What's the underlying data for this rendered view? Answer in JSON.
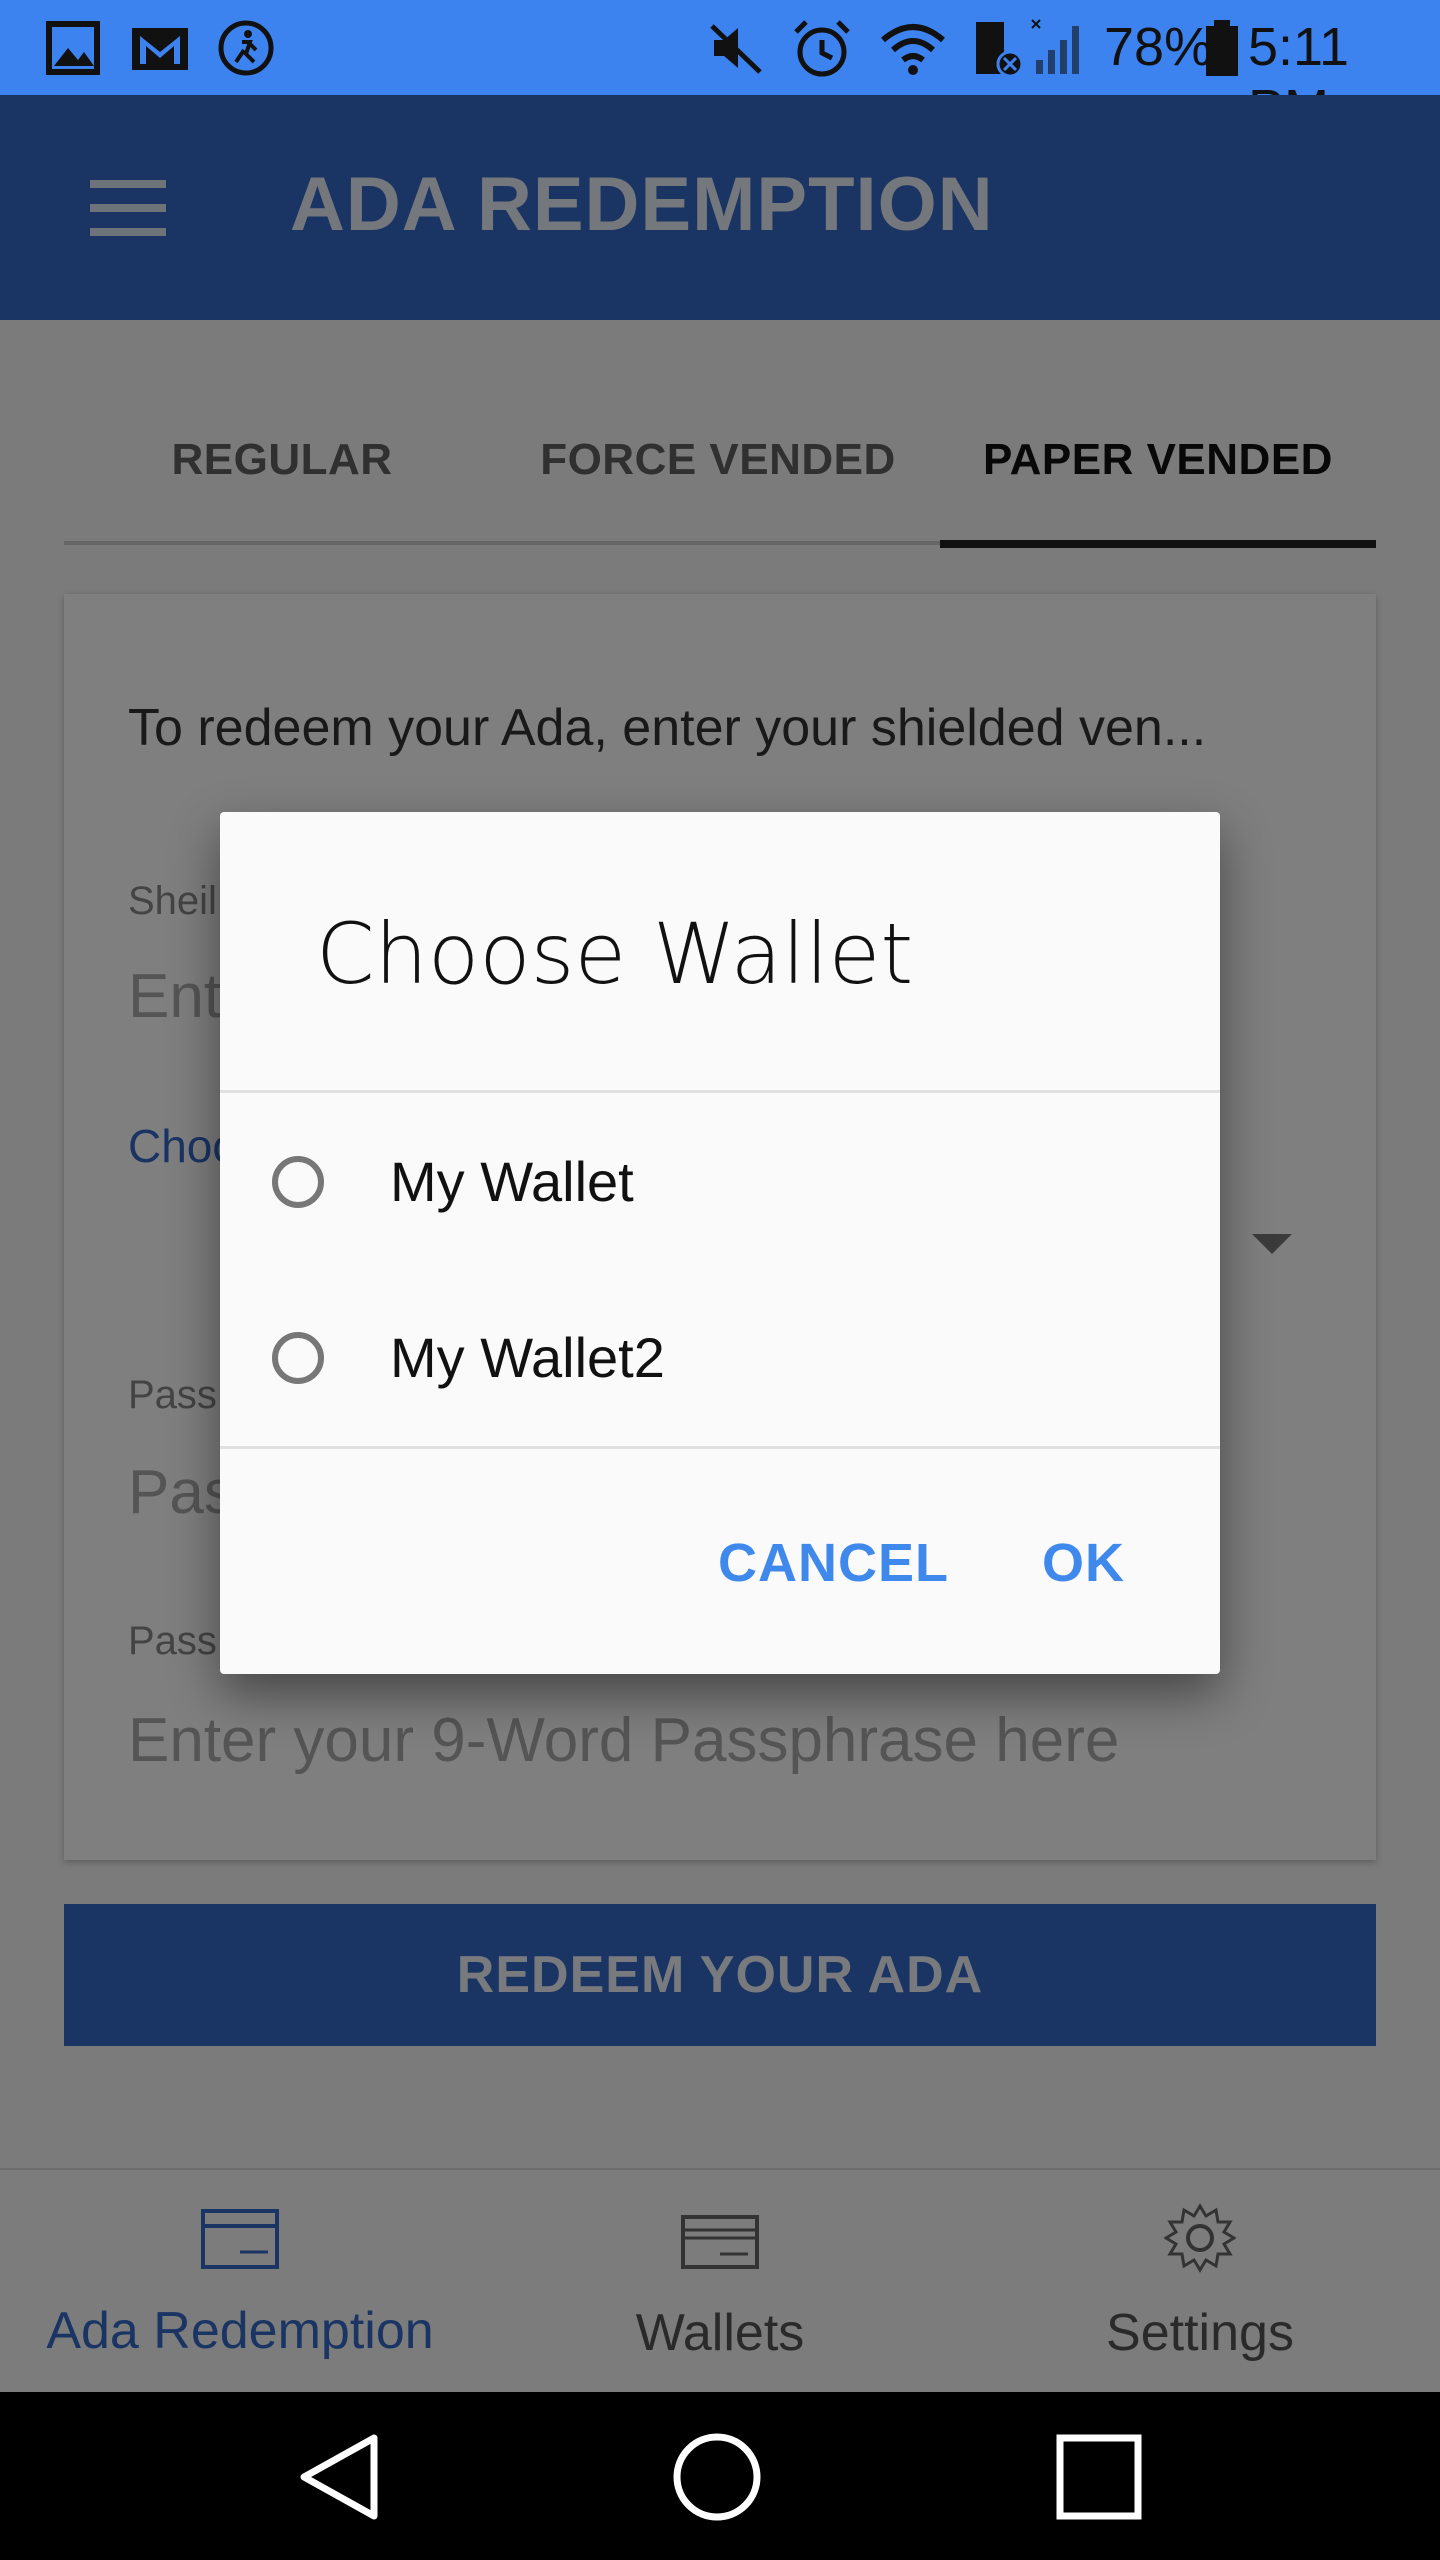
{
  "status_bar": {
    "battery": "78%",
    "time": "5:11 PM"
  },
  "app_bar": {
    "title": "ADA REDEMPTION"
  },
  "tabs": [
    {
      "label": "REGULAR",
      "active": false
    },
    {
      "label": "FORCE VENDED",
      "active": false
    },
    {
      "label": "PAPER VENDED",
      "active": true
    }
  ],
  "card": {
    "instructions": "To redeem your Ada, enter your shielded ven...",
    "shielded_label": "Sheil",
    "shielded_placeholder": "Ent",
    "choose_wallet_label": "Choo",
    "passphrase_label_partial": "Pass",
    "passphrase_placeholder_partial": "Pas",
    "passphrase9_label": "Pass",
    "passphrase9_placeholder": "Enter your 9-Word Passphrase here"
  },
  "redeem_button": "REDEEM YOUR ADA",
  "bottom_nav": [
    {
      "label": "Ada Redemption",
      "icon": "card-icon",
      "active": true
    },
    {
      "label": "Wallets",
      "icon": "wallet-icon",
      "active": false
    },
    {
      "label": "Settings",
      "icon": "gear-icon",
      "active": false
    }
  ],
  "dialog": {
    "title": "Choose Wallet",
    "options": [
      {
        "label": "My Wallet",
        "selected": false
      },
      {
        "label": "My Wallet2",
        "selected": false
      }
    ],
    "cancel_label": "CANCEL",
    "ok_label": "OK"
  },
  "colors": {
    "status_bar": "#3c83ef",
    "app_bar": "#3569c9",
    "accent": "#3f88ec",
    "active_nav": "#3569c9"
  }
}
